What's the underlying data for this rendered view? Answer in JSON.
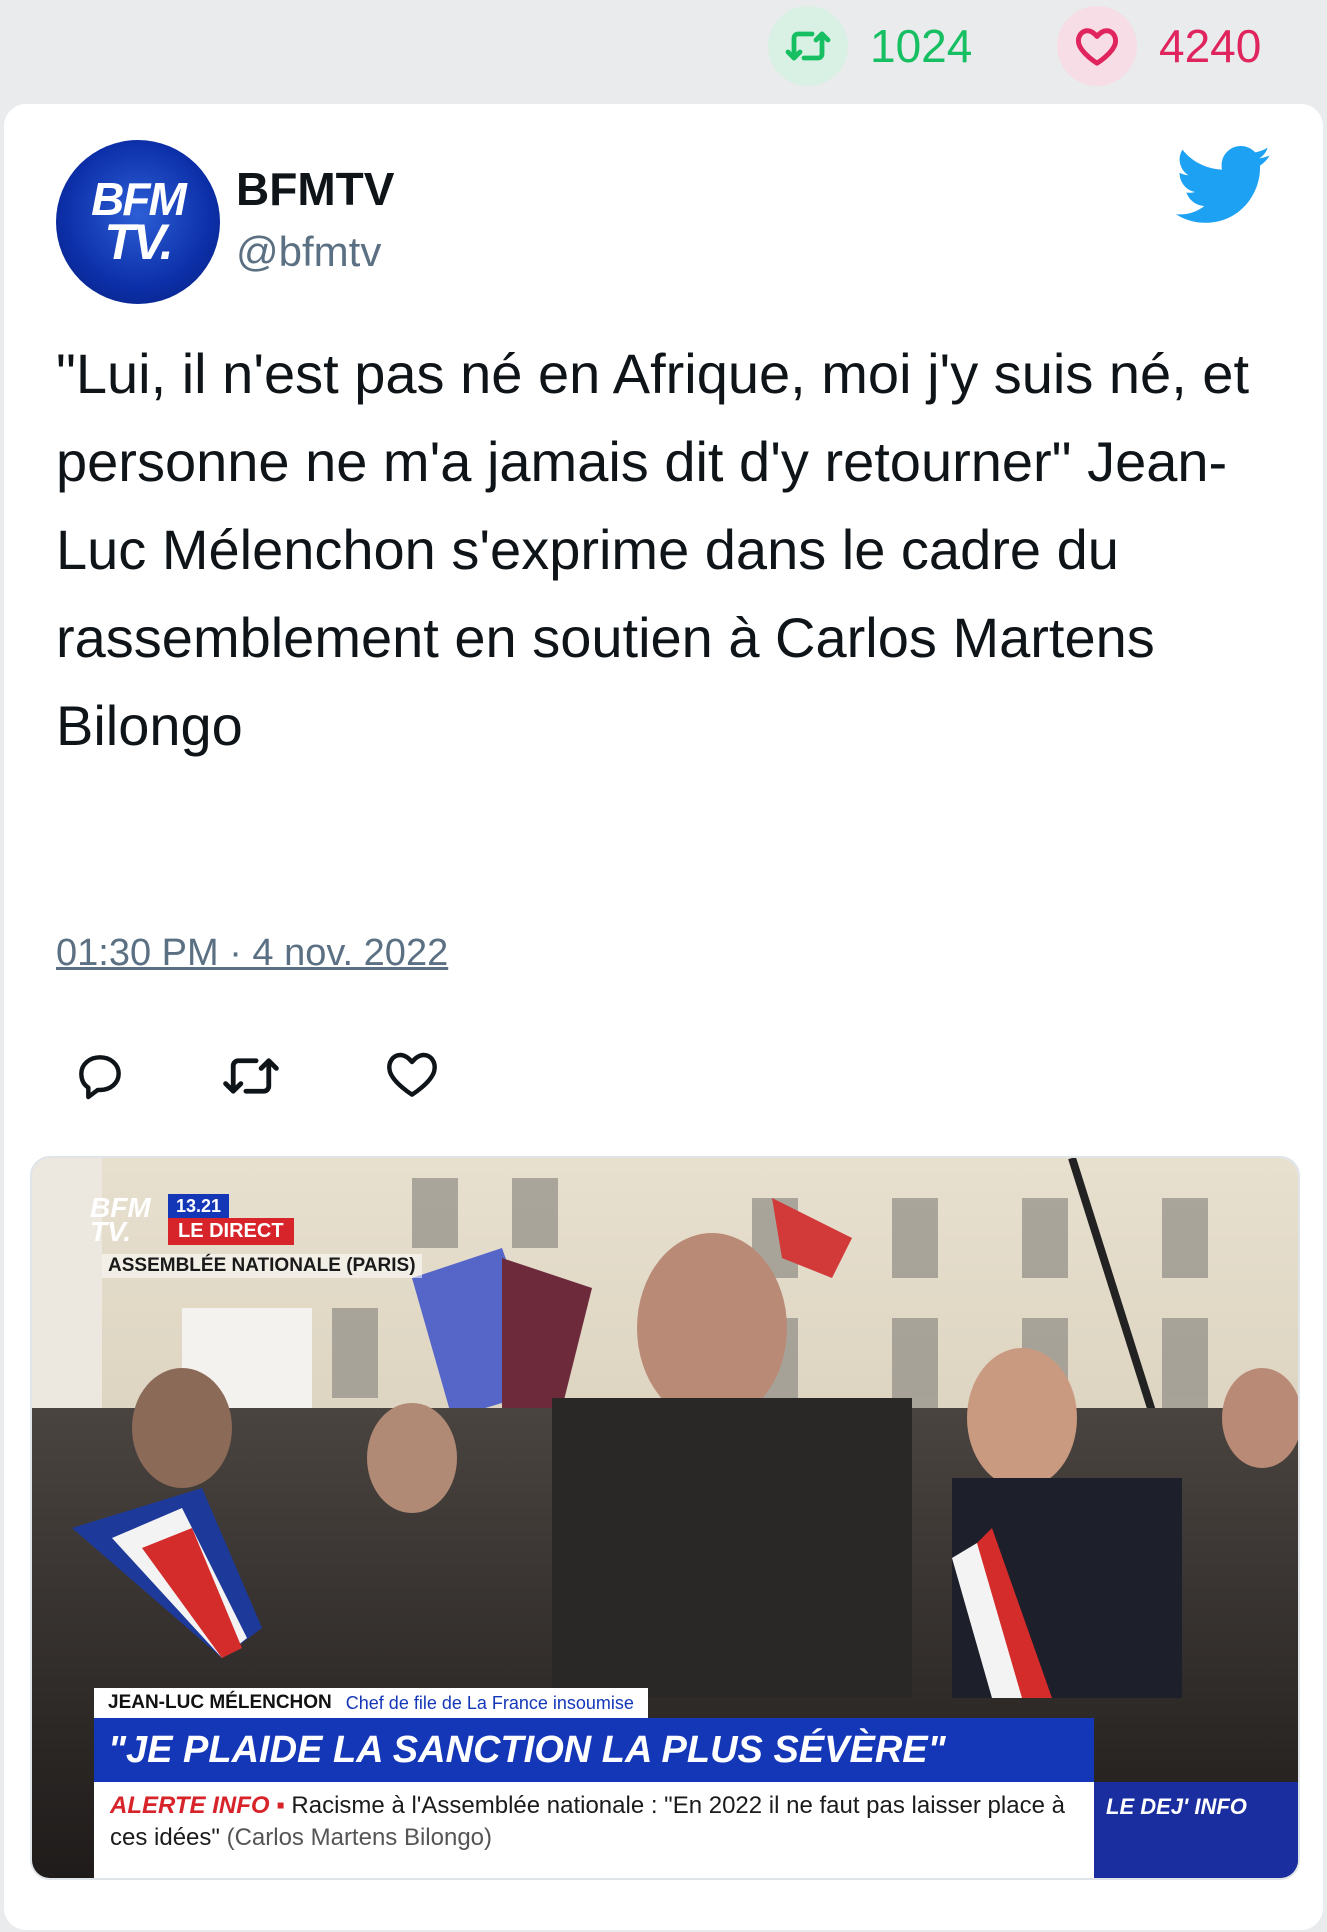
{
  "stats": {
    "retweets": "1024",
    "likes": "4240"
  },
  "author": {
    "name": "BFMTV",
    "handle": "@bfmtv",
    "avatar_text_line1": "BFM",
    "avatar_text_line2": "TV."
  },
  "tweet": {
    "text": "\"Lui, il n'est pas né en Afrique, moi j'y suis né, et personne ne m'a jamais dit d'y retourner\" Jean-Luc Mélenchon s'exprime dans le cadre du rassemblement en soutien à Carlos Martens Bilongo",
    "timestamp": "01:30 PM · 4 nov. 2022"
  },
  "media": {
    "logo_line1": "BFM",
    "logo_line2": "TV.",
    "time": "13.21",
    "live": "LE DIRECT",
    "location": "ASSEMBLÉE NATIONALE (PARIS)",
    "speaker_name": "JEAN-LUC MÉLENCHON",
    "speaker_title": "Chef de file de La France insoumise",
    "headline": "\"JE PLAIDE LA SANCTION LA PLUS SÉVÈRE\"",
    "alert_label": "ALERTE INFO ▪",
    "alert_text": " Racisme à l'Assemblée nationale : \"En 2022 il ne faut pas laisser place à ces idées\"",
    "alert_source": " (Carlos Martens Bilongo)",
    "corner_label": "LE DEJ' INFO"
  },
  "colors": {
    "retweet_green": "#17bf63",
    "like_red": "#e0245e",
    "twitter_blue": "#1da1f2",
    "bfm_blue": "#1437b8"
  },
  "icons": [
    "retweet-icon",
    "heart-icon",
    "twitter-bird-icon",
    "reply-icon",
    "retweet-action-icon",
    "like-action-icon"
  ]
}
